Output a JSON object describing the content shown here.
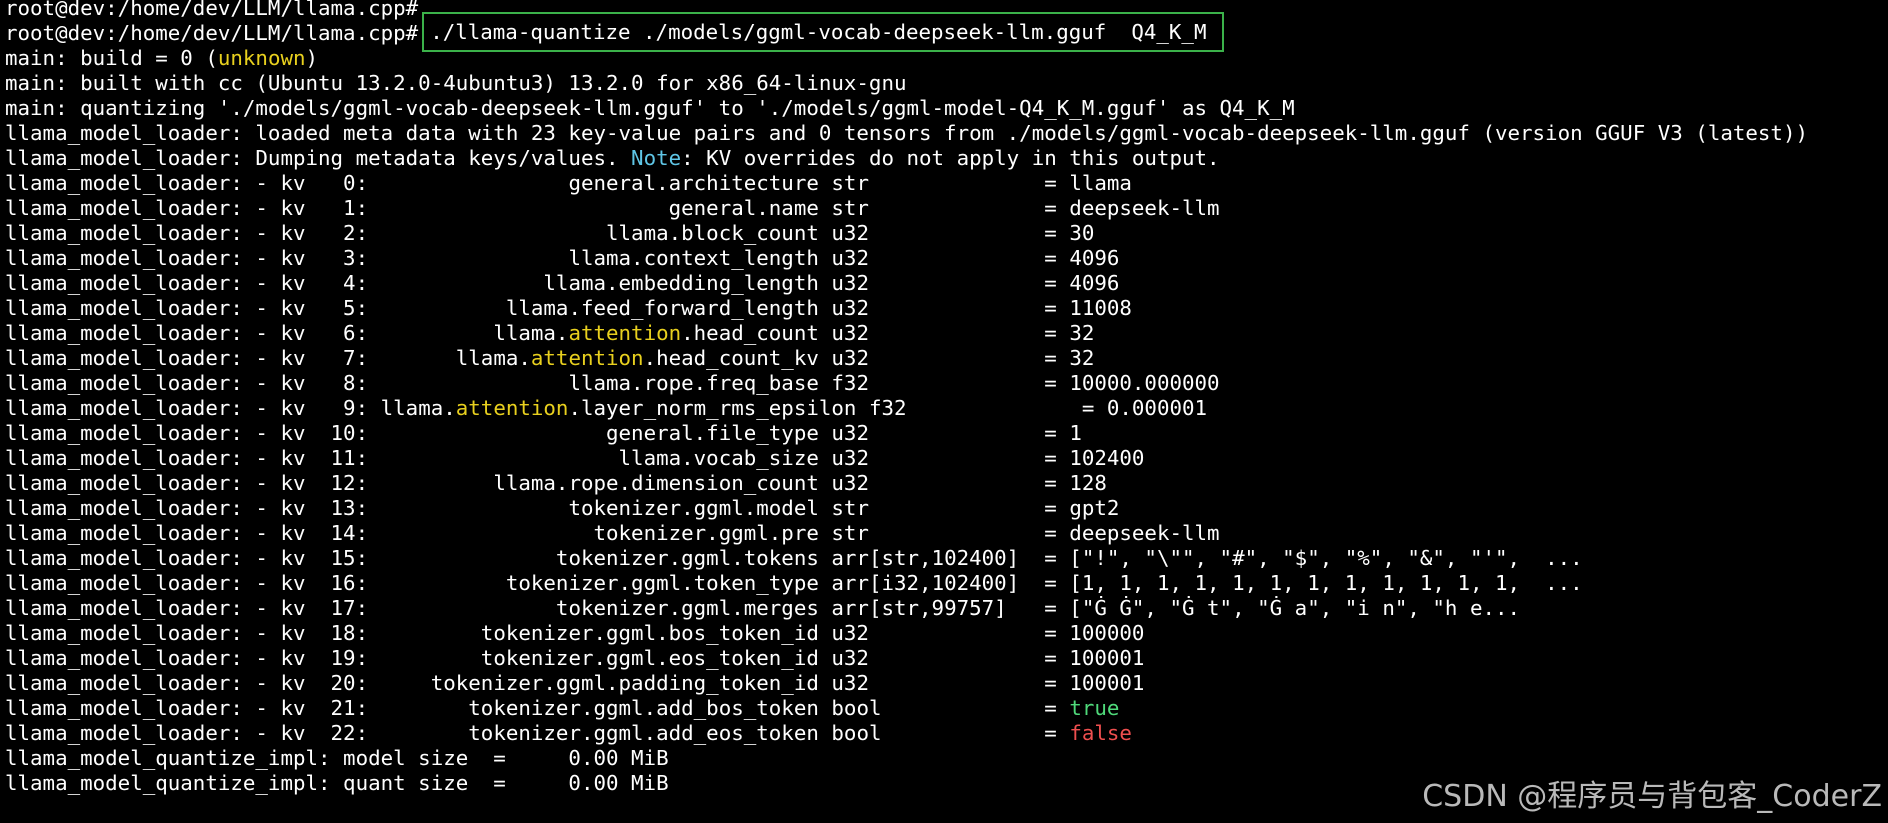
{
  "terminal": {
    "prompt1": "root@dev:/home/dev/LLM/llama.cpp#",
    "prompt2": "root@dev:/home/dev/LLM/llama.cpp#",
    "command": "./llama-quantize ./models/ggml-vocab-deepseek-llm.gguf  Q4_K_M",
    "build_prefix": "main: build = 0 (",
    "build_value": "unknown",
    "build_suffix": ")",
    "built_with": "main: built with cc (Ubuntu 13.2.0-4ubuntu3) 13.2.0 for x86_64-linux-gnu",
    "quantizing": "main: quantizing './models/ggml-vocab-deepseek-llm.gguf' to './models/ggml-model-Q4_K_M.gguf' as Q4_K_M",
    "loaded": "llama_model_loader: loaded meta data with 23 key-value pairs and 0 tensors from ./models/ggml-vocab-deepseek-llm.gguf (version GGUF V3 (latest))",
    "dumping_prefix": "llama_model_loader: Dumping metadata keys/values. ",
    "dumping_note": "Note",
    "dumping_suffix": ": KV overrides do not apply in this output.",
    "kv_rows": [
      {
        "prefix": "llama_model_loader: - kv   0:",
        "key": "general.architecture",
        "type": "str",
        "value": "llama"
      },
      {
        "prefix": "llama_model_loader: - kv   1:",
        "key": "general.name",
        "type": "str",
        "value": "deepseek-llm"
      },
      {
        "prefix": "llama_model_loader: - kv   2:",
        "key": "llama.block_count",
        "type": "u32",
        "value": "30"
      },
      {
        "prefix": "llama_model_loader: - kv   3:",
        "key": "llama.context_length",
        "type": "u32",
        "value": "4096"
      },
      {
        "prefix": "llama_model_loader: - kv   4:",
        "key": "llama.embedding_length",
        "type": "u32",
        "value": "4096"
      },
      {
        "prefix": "llama_model_loader: - kv   5:",
        "key": "llama.feed_forward_length",
        "type": "u32",
        "value": "11008"
      },
      {
        "prefix": "llama_model_loader: - kv   6:",
        "key_a": "llama.",
        "key_hl": "attention",
        "key_b": ".head_count",
        "type": "u32",
        "value": "32"
      },
      {
        "prefix": "llama_model_loader: - kv   7:",
        "key_a": "llama.",
        "key_hl": "attention",
        "key_b": ".head_count_kv",
        "type": "u32",
        "value": "32"
      },
      {
        "prefix": "llama_model_loader: - kv   8:",
        "key": "llama.rope.freq_base",
        "type": "f32",
        "value": "10000.000000"
      },
      {
        "prefix": "llama_model_loader: - kv   9:",
        "key_a": "llama.",
        "key_hl": "attention",
        "key_b": ".layer_norm_rms_epsilon",
        "type": "f32",
        "value": "0.000001"
      },
      {
        "prefix": "llama_model_loader: - kv  10:",
        "key": "general.file_type",
        "type": "u32",
        "value": "1"
      },
      {
        "prefix": "llama_model_loader: - kv  11:",
        "key": "llama.vocab_size",
        "type": "u32",
        "value": "102400"
      },
      {
        "prefix": "llama_model_loader: - kv  12:",
        "key": "llama.rope.dimension_count",
        "type": "u32",
        "value": "128"
      },
      {
        "prefix": "llama_model_loader: - kv  13:",
        "key": "tokenizer.ggml.model",
        "type": "str",
        "value": "gpt2"
      },
      {
        "prefix": "llama_model_loader: - kv  14:",
        "key": "tokenizer.ggml.pre",
        "type": "str",
        "value": "deepseek-llm"
      },
      {
        "prefix": "llama_model_loader: - kv  15:",
        "key": "tokenizer.ggml.tokens",
        "type": "arr[str,102400]",
        "value": "[\"!\", \"\\\"\", \"#\", \"$\", \"%\", \"&\", \"'\",  ..."
      },
      {
        "prefix": "llama_model_loader: - kv  16:",
        "key": "tokenizer.ggml.token_type",
        "type": "arr[i32,102400]",
        "value": "[1, 1, 1, 1, 1, 1, 1, 1, 1, 1, 1, 1,  ..."
      },
      {
        "prefix": "llama_model_loader: - kv  17:",
        "key": "tokenizer.ggml.merges",
        "type": "arr[str,99757]",
        "value": "[\"Ġ Ġ\", \"Ġ t\", \"Ġ a\", \"i n\", \"h e..."
      },
      {
        "prefix": "llama_model_loader: - kv  18:",
        "key": "tokenizer.ggml.bos_token_id",
        "type": "u32",
        "value": "100000"
      },
      {
        "prefix": "llama_model_loader: - kv  19:",
        "key": "tokenizer.ggml.eos_token_id",
        "type": "u32",
        "value": "100001"
      },
      {
        "prefix": "llama_model_loader: - kv  20:",
        "key": "tokenizer.ggml.padding_token_id",
        "type": "u32",
        "value": "100001"
      },
      {
        "prefix": "llama_model_loader: - kv  21:",
        "key": "tokenizer.ggml.add_bos_token",
        "type": "bool",
        "value": "true",
        "value_color": "#4fd97a"
      },
      {
        "prefix": "llama_model_loader: - kv  22:",
        "key": "tokenizer.ggml.add_eos_token",
        "type": "bool",
        "value": "false",
        "value_color": "#ef4f4f"
      }
    ],
    "model_size": "llama_model_quantize_impl: model size  =     0.00 MiB",
    "quant_size": "llama_model_quantize_impl: quant size  =     0.00 MiB"
  },
  "watermark": "CSDN @程序员与背包客_CoderZ",
  "colors": {
    "background": "#000000",
    "text": "#ffffff",
    "highlight_yellow": "#e8d01e",
    "note_cyan": "#5fc6e6",
    "true_green": "#4fd97a",
    "false_red": "#ef4f4f",
    "command_box_border": "#3bb24a"
  }
}
